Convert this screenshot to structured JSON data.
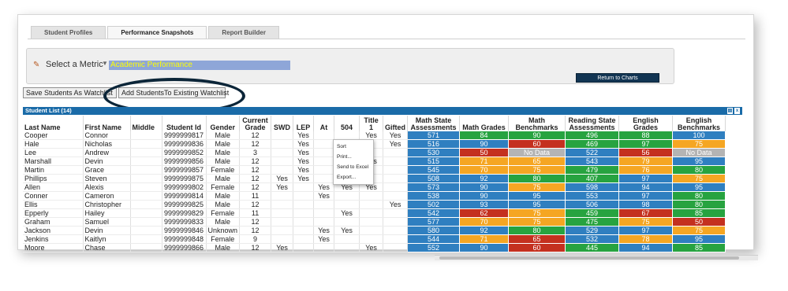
{
  "tabs": [
    "Student Profiles",
    "Performance Snapshots",
    "Report Builder"
  ],
  "metric": {
    "label": "Select a Metric",
    "selected": "Academic Performance"
  },
  "return_button": "Return to Charts",
  "buttons": {
    "save_watchlist": "Save Students As Watchlist",
    "add_existing": "Add StudentsTo Existing Watchlist"
  },
  "list_title": "Student List (14)",
  "columns": [
    "Last Name",
    "First Name",
    "Middle",
    "Student Id",
    "Gender",
    "Current Grade",
    "SWD",
    "LEP",
    "At",
    "504",
    "Title 1",
    "Gifted",
    "Math State Assessments",
    "Math Grades",
    "Math Benchmarks",
    "Reading State Assessments",
    "English Grades",
    "English Benchmarks"
  ],
  "rows": [
    [
      "Cooper",
      "Connor",
      "",
      "9999999817",
      "Male",
      "12",
      "",
      "Yes",
      "",
      "",
      "Yes",
      "Yes",
      "571",
      "84",
      "90",
      "496",
      "88",
      "100"
    ],
    [
      "Hale",
      "Nicholas",
      "",
      "9999999836",
      "Male",
      "12",
      "",
      "Yes",
      "",
      "",
      "",
      "Yes",
      "516",
      "90",
      "60",
      "469",
      "97",
      "75"
    ],
    [
      "Lee",
      "Andrew",
      "",
      "9999999852",
      "Male",
      "3",
      "",
      "Yes",
      "",
      "",
      "",
      "",
      "530",
      "50",
      "No Data",
      "522",
      "56",
      "No Data"
    ],
    [
      "Marshall",
      "Devin",
      "",
      "9999999856",
      "Male",
      "12",
      "",
      "Yes",
      "",
      "",
      "Yes",
      "",
      "515",
      "71",
      "65",
      "543",
      "79",
      "95"
    ],
    [
      "Martin",
      "Grace",
      "",
      "9999999857",
      "Female",
      "12",
      "",
      "Yes",
      "",
      "Yes",
      "",
      "",
      "545",
      "70",
      "75",
      "479",
      "76",
      "80"
    ],
    [
      "Phillips",
      "Steven",
      "",
      "9999999875",
      "Male",
      "12",
      "Yes",
      "Yes",
      "",
      "Yes",
      "",
      "",
      "508",
      "92",
      "80",
      "407",
      "97",
      "75"
    ],
    [
      "Allen",
      "Alexis",
      "",
      "9999999802",
      "Female",
      "12",
      "Yes",
      "",
      "Yes",
      "Yes",
      "Yes",
      "",
      "573",
      "90",
      "75",
      "598",
      "94",
      "95"
    ],
    [
      "Conner",
      "Cameron",
      "",
      "9999999814",
      "Male",
      "11",
      "",
      "",
      "Yes",
      "",
      "",
      "",
      "538",
      "90",
      "95",
      "553",
      "97",
      "80"
    ],
    [
      "Ellis",
      "Christopher",
      "",
      "9999999825",
      "Male",
      "12",
      "",
      "",
      "",
      "",
      "",
      "Yes",
      "502",
      "93",
      "95",
      "506",
      "98",
      "80"
    ],
    [
      "Epperly",
      "Hailey",
      "",
      "9999999829",
      "Female",
      "11",
      "",
      "",
      "",
      "Yes",
      "",
      "",
      "542",
      "62",
      "75",
      "459",
      "67",
      "85"
    ],
    [
      "Graham",
      "Samuel",
      "",
      "9999999833",
      "Male",
      "12",
      "",
      "",
      "",
      "",
      "",
      "",
      "577",
      "70",
      "75",
      "475",
      "75",
      "50"
    ],
    [
      "Jackson",
      "Devin",
      "",
      "9999999846",
      "Unknown",
      "12",
      "",
      "",
      "Yes",
      "Yes",
      "",
      "",
      "580",
      "92",
      "80",
      "529",
      "97",
      "75"
    ],
    [
      "Jenkins",
      "Kaitlyn",
      "",
      "9999999848",
      "Female",
      "9",
      "",
      "",
      "Yes",
      "",
      "",
      "",
      "544",
      "71",
      "65",
      "532",
      "78",
      "95"
    ],
    [
      "Moore",
      "Chase",
      "",
      "9999999866",
      "Male",
      "12",
      "Yes",
      "",
      "",
      "",
      "Yes",
      "",
      "552",
      "90",
      "60",
      "445",
      "94",
      "85"
    ]
  ],
  "score_colors": [
    [
      "blue",
      "green",
      "green",
      "green",
      "green",
      "blue"
    ],
    [
      "blue",
      "blue",
      "red",
      "green",
      "green",
      "orange"
    ],
    [
      "blue",
      "red",
      "grey",
      "blue",
      "red",
      "grey"
    ],
    [
      "blue",
      "orange",
      "orange",
      "blue",
      "orange",
      "blue"
    ],
    [
      "blue",
      "orange",
      "orange",
      "green",
      "orange",
      "green"
    ],
    [
      "blue",
      "blue",
      "green",
      "green",
      "blue",
      "orange"
    ],
    [
      "blue",
      "blue",
      "orange",
      "blue",
      "blue",
      "blue"
    ],
    [
      "blue",
      "blue",
      "blue",
      "blue",
      "blue",
      "green"
    ],
    [
      "blue",
      "blue",
      "blue",
      "blue",
      "blue",
      "green"
    ],
    [
      "blue",
      "red",
      "orange",
      "green",
      "red",
      "green"
    ],
    [
      "blue",
      "orange",
      "orange",
      "green",
      "orange",
      "red"
    ],
    [
      "blue",
      "blue",
      "green",
      "blue",
      "blue",
      "orange"
    ],
    [
      "blue",
      "orange",
      "red",
      "blue",
      "orange",
      "blue"
    ],
    [
      "blue",
      "blue",
      "red",
      "green",
      "blue",
      "green"
    ]
  ],
  "context_menu": [
    "Sort",
    "Print...",
    "Send to Excel",
    "Export..."
  ],
  "colors": {
    "header_bar": "#1a6ba8",
    "blue": "#2f7fc0",
    "green": "#27a340",
    "red": "#c4301f",
    "orange": "#f5a623",
    "grey": "#b4b4b4",
    "metric_text": "#ffff00"
  }
}
